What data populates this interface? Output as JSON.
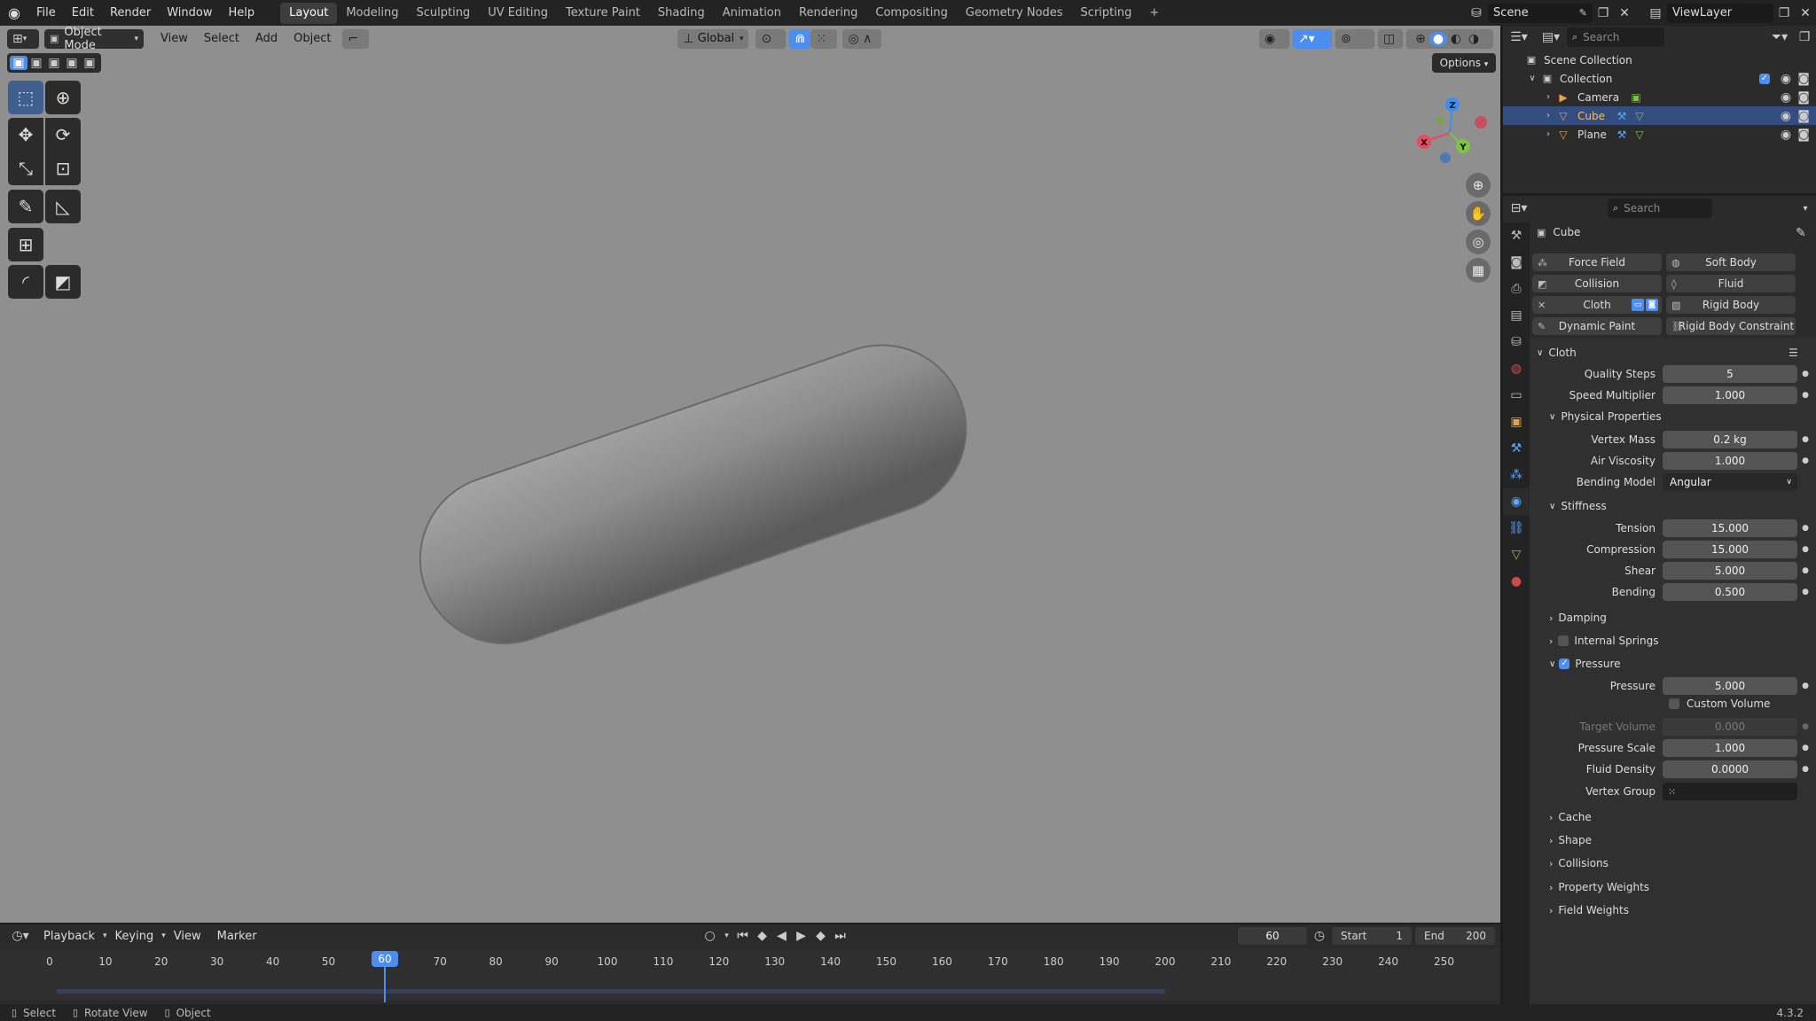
{
  "topbar": {
    "menus": [
      "File",
      "Edit",
      "Render",
      "Window",
      "Help"
    ],
    "workspaces": [
      "Layout",
      "Modeling",
      "Sculpting",
      "UV Editing",
      "Texture Paint",
      "Shading",
      "Animation",
      "Rendering",
      "Compositing",
      "Geometry Nodes",
      "Scripting"
    ],
    "active_workspace": "Layout",
    "add_tab": "+",
    "scene": "Scene",
    "view_layer": "ViewLayer"
  },
  "viewport_header": {
    "mode": "Object Mode",
    "menus": [
      "View",
      "Select",
      "Add",
      "Object"
    ],
    "transform": "Global",
    "options": "Options"
  },
  "gizmo": {
    "z": "Z",
    "x": "X",
    "y": "Y"
  },
  "outliner": {
    "search_placeholder": "Search",
    "scene_collection": "Scene Collection",
    "collection": "Collection",
    "items": [
      {
        "name": "Camera",
        "selected": false
      },
      {
        "name": "Cube",
        "selected": true
      },
      {
        "name": "Plane",
        "selected": false
      }
    ]
  },
  "properties": {
    "search_placeholder": "Search",
    "object_name": "Cube",
    "physics_buttons": [
      {
        "label": "Force Field",
        "icon": "force-field-icon"
      },
      {
        "label": "Soft Body",
        "icon": "soft-body-icon"
      },
      {
        "label": "Collision",
        "icon": "collision-icon"
      },
      {
        "label": "Fluid",
        "icon": "fluid-icon"
      },
      {
        "label": "Cloth",
        "icon": "close-icon"
      },
      {
        "label": "Rigid Body",
        "icon": "rigid-body-icon"
      },
      {
        "label": "Dynamic Paint",
        "icon": "dynamic-paint-icon"
      },
      {
        "label": "Rigid Body Constraint",
        "icon": "rigid-body-constraint-icon"
      }
    ],
    "cloth_panel": "Cloth",
    "quality_steps": {
      "label": "Quality Steps",
      "value": "5"
    },
    "speed_multiplier": {
      "label": "Speed Multiplier",
      "value": "1.000"
    },
    "physical_properties": "Physical Properties",
    "vertex_mass": {
      "label": "Vertex Mass",
      "value": "0.2 kg"
    },
    "air_viscosity": {
      "label": "Air Viscosity",
      "value": "1.000"
    },
    "bending_model": {
      "label": "Bending Model",
      "value": "Angular"
    },
    "stiffness": "Stiffness",
    "tension": {
      "label": "Tension",
      "value": "15.000"
    },
    "compression": {
      "label": "Compression",
      "value": "15.000"
    },
    "shear": {
      "label": "Shear",
      "value": "5.000"
    },
    "bending": {
      "label": "Bending",
      "value": "0.500"
    },
    "damping": "Damping",
    "internal_springs": "Internal Springs",
    "pressure_panel": "Pressure",
    "pressure": {
      "label": "Pressure",
      "value": "5.000"
    },
    "custom_volume": "Custom Volume",
    "target_volume": {
      "label": "Target Volume",
      "value": "0.000"
    },
    "pressure_scale": {
      "label": "Pressure Scale",
      "value": "1.000"
    },
    "fluid_density": {
      "label": "Fluid Density",
      "value": "0.0000"
    },
    "vertex_group": {
      "label": "Vertex Group",
      "value": ""
    },
    "collapsed_panels": [
      "Cache",
      "Shape",
      "Collisions",
      "Property Weights",
      "Field Weights"
    ]
  },
  "timeline": {
    "menus": [
      "Playback",
      "Keying",
      "View",
      "Marker"
    ],
    "current_frame": "60",
    "start_label": "Start",
    "start": "1",
    "end_label": "End",
    "end": "200",
    "ticks": [
      "0",
      "10",
      "20",
      "30",
      "40",
      "50",
      "60",
      "70",
      "80",
      "90",
      "100",
      "110",
      "120",
      "130",
      "140",
      "150",
      "160",
      "170",
      "180",
      "190",
      "200",
      "210",
      "220",
      "230",
      "240",
      "250"
    ]
  },
  "statusbar": {
    "select": "Select",
    "rotate": "Rotate View",
    "object": "Object",
    "version": "4.3.2"
  },
  "colors": {
    "accent": "#4b8ef0",
    "selection": "#334d80",
    "viewport": "#8f8f8f",
    "x_axis": "#e84b5c",
    "y_axis": "#7fc43f",
    "z_axis": "#3e8ef0"
  }
}
